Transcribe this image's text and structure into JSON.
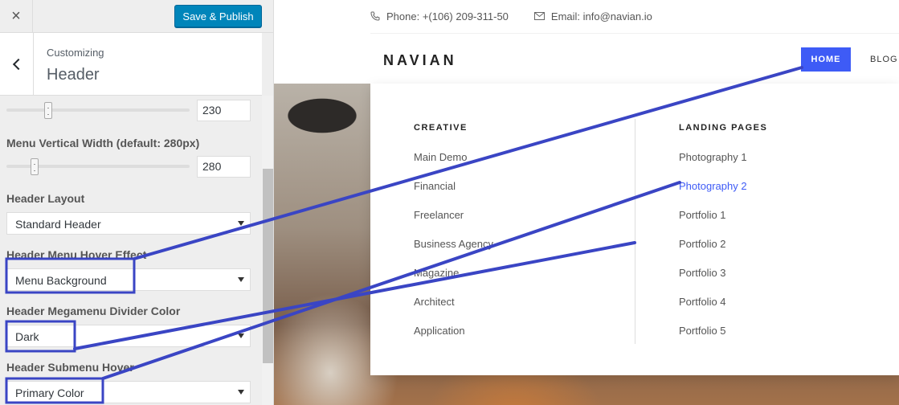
{
  "customizer": {
    "close_label": "×",
    "publish_label": "Save & Publish",
    "breadcrumb": "Customizing",
    "section_title": "Header",
    "controls": {
      "menu_height_value": "230",
      "menu_vertical_width_label": "Menu Vertical Width (default: 280px)",
      "menu_vertical_width_value": "280",
      "header_layout_label": "Header Layout",
      "header_layout_value": "Standard Header",
      "hover_effect_label": "Header Menu Hover Effect",
      "hover_effect_value": "Menu Background",
      "divider_color_label": "Header Megamenu Divider Color",
      "divider_color_value": "Dark",
      "submenu_hover_label": "Header Submenu Hover",
      "submenu_hover_value": "Primary Color"
    }
  },
  "site": {
    "phone": "Phone: +(106) 209-311-50",
    "email": "Email: info@navian.io",
    "logo": "NAVIAN",
    "nav": {
      "home": "HOME",
      "blog": "BLOG"
    },
    "megamenu": {
      "col1": {
        "heading": "CREATIVE",
        "items": [
          "Main Demo",
          "Financial",
          "Freelancer",
          "Business Agency",
          "Magazine",
          "Architect",
          "Application"
        ]
      },
      "col2": {
        "heading": "LANDING PAGES",
        "items": [
          "Photography 1",
          "Photography 2",
          "Portfolio 1",
          "Portfolio 2",
          "Portfolio 3",
          "Portfolio 4",
          "Portfolio 5"
        ]
      }
    }
  },
  "colors": {
    "publish": "#0085ba",
    "accent": "#3e5bf6",
    "annotation": "#3a45c4"
  }
}
